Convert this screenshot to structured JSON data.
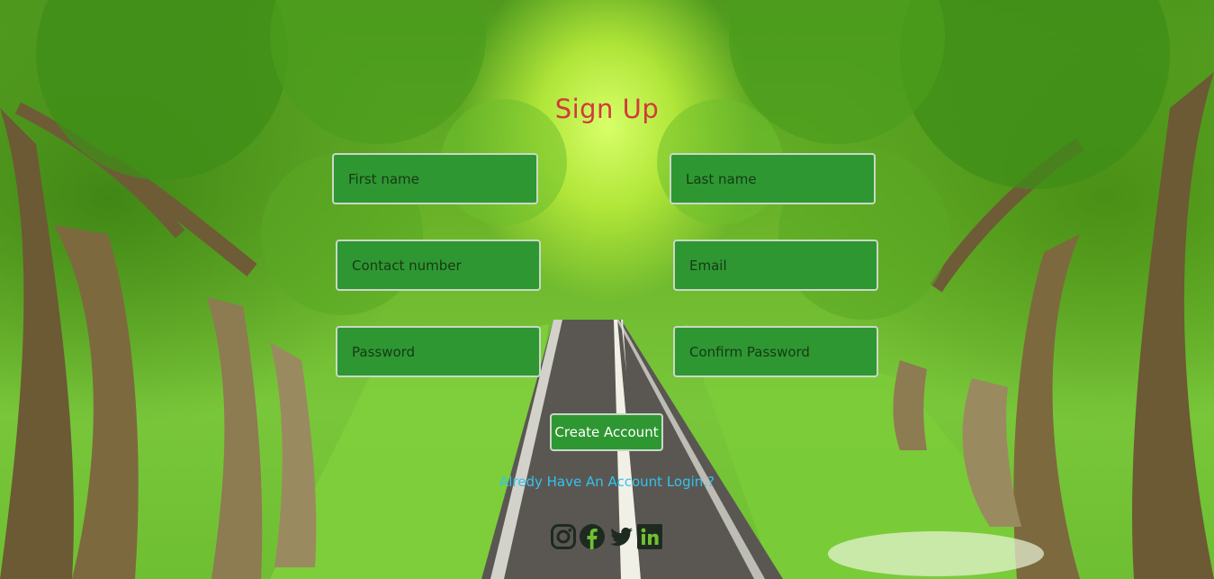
{
  "page": {
    "title": "Sign Up"
  },
  "form": {
    "first_name_placeholder": "First name",
    "last_name_placeholder": "Last name",
    "contact_placeholder": "Contact number",
    "email_placeholder": "Email",
    "password_placeholder": "Password",
    "confirm_password_placeholder": "Confirm Password",
    "submit_label": "Create Account"
  },
  "login_link": "Alredy Have An Account Login.?",
  "socials": [
    {
      "icon": "instagram-icon"
    },
    {
      "icon": "facebook-icon"
    },
    {
      "icon": "twitter-icon"
    },
    {
      "icon": "linkedin-icon"
    }
  ],
  "colors": {
    "title": "#d23a3a",
    "field_bg": "#2e9732",
    "link": "#33c3ee",
    "icon": "#1e2a20"
  }
}
